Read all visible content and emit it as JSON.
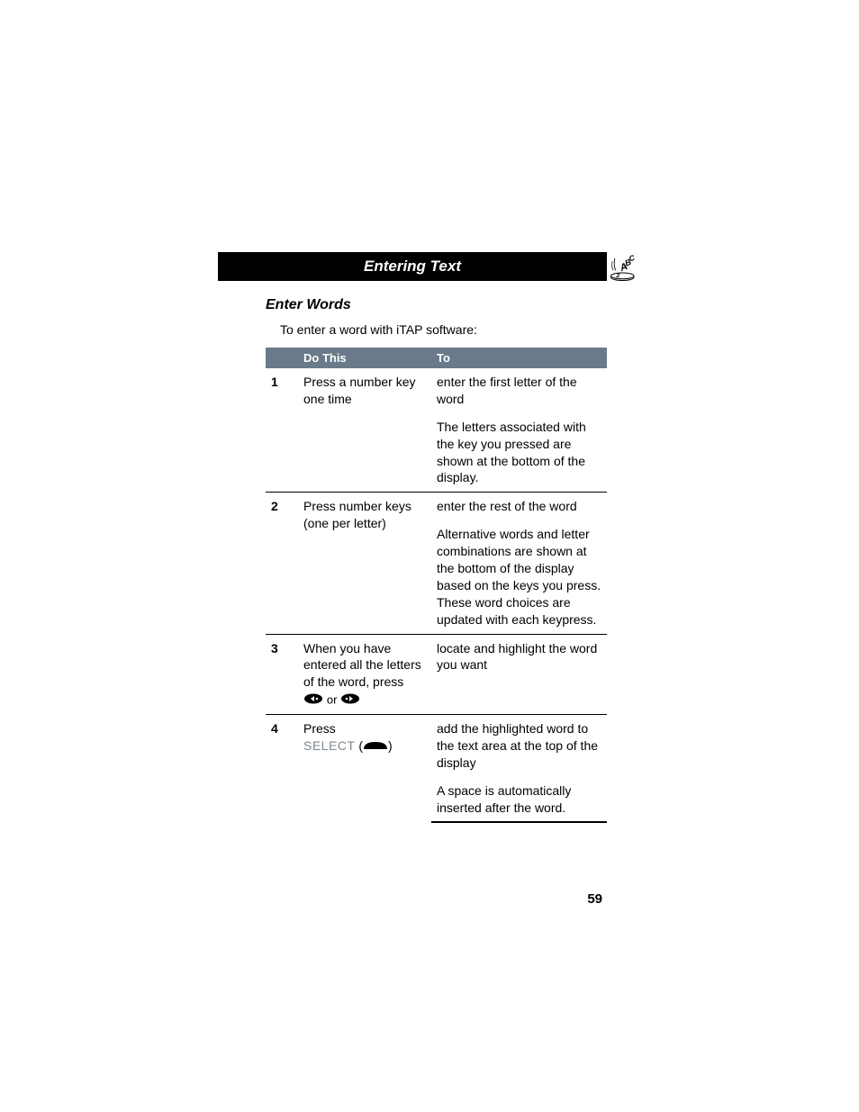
{
  "header": {
    "title": "Entering Text"
  },
  "section": {
    "heading": "Enter Words",
    "intro": "To enter a word with iTAP software:"
  },
  "table": {
    "col1_header": "Do This",
    "col2_header": "To",
    "rows": [
      {
        "num": "1",
        "do_text": "Press a number key one time",
        "to_main": "enter the first letter of the word",
        "to_sub": "The letters associated with the key you pressed are shown at the bottom of the display."
      },
      {
        "num": "2",
        "do_text": "Press number keys (one per letter)",
        "to_main": "enter the rest of the word",
        "to_sub": "Alternative words and letter combinations are shown at the bottom of the display based on the keys you press. These word choices are updated with each keypress."
      },
      {
        "num": "3",
        "do_text": "When you have entered all the letters of the word, press",
        "arrow_sep": " or ",
        "to_main": "locate and highlight the word you want",
        "to_sub": ""
      },
      {
        "num": "4",
        "do_text_prefix": "Press",
        "select_label": "SELECT",
        "to_main": "add the highlighted word to the text area at the top of the display",
        "to_sub": "A space is automatically inserted after the word."
      }
    ]
  },
  "page_number": "59"
}
